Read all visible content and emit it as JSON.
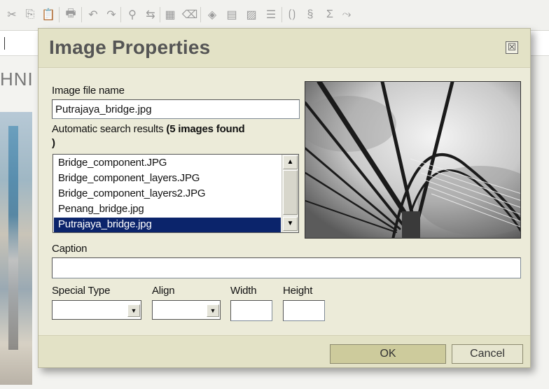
{
  "background": {
    "heading_fragment": "HNI",
    "toolbar_icons": [
      {
        "name": "cut-icon",
        "glyph": "✂"
      },
      {
        "name": "copy-icon",
        "glyph": "⎘"
      },
      {
        "name": "paste-icon",
        "glyph": "📋"
      },
      {
        "name": "print-icon",
        "glyph": "🖶"
      },
      {
        "name": "undo-icon",
        "glyph": "↶"
      },
      {
        "name": "redo-icon",
        "glyph": "↷"
      },
      {
        "name": "find-icon",
        "glyph": "⚲"
      },
      {
        "name": "replace-icon",
        "glyph": "⇆"
      },
      {
        "name": "select-all-icon",
        "glyph": "▦"
      },
      {
        "name": "eraser-icon",
        "glyph": "⌫"
      },
      {
        "name": "object-icon",
        "glyph": "◈"
      },
      {
        "name": "table-icon",
        "glyph": "▤"
      },
      {
        "name": "image-icon",
        "glyph": "▨"
      },
      {
        "name": "horizontal-rule-icon",
        "glyph": "☰"
      },
      {
        "name": "template-icon",
        "glyph": "⟮⟯"
      },
      {
        "name": "special-char-icon",
        "glyph": "§"
      },
      {
        "name": "sum-icon",
        "glyph": "Σ"
      },
      {
        "name": "more-icon",
        "glyph": "⤳"
      }
    ]
  },
  "dialog": {
    "title": "Image Properties",
    "close_label": "☒",
    "file_name": {
      "label": "Image file name",
      "value": "Putrajaya_bridge.jpg"
    },
    "search": {
      "label": "Automatic search results ",
      "count_text": "(5 images found",
      "count_close": ")"
    },
    "results": [
      "Bridge_component.JPG",
      "Bridge_component_layers.JPG",
      "Bridge_component_layers2.JPG",
      "Penang_bridge.jpg",
      "Putrajaya_bridge.jpg"
    ],
    "selected_index": 4,
    "scroll_up": "▲",
    "scroll_down": "▼",
    "caption": {
      "label": "Caption",
      "value": ""
    },
    "special_type": {
      "label": "Special Type",
      "value": ""
    },
    "align": {
      "label": "Align",
      "value": ""
    },
    "width": {
      "label": "Width",
      "value": ""
    },
    "height": {
      "label": "Height",
      "value": ""
    },
    "dropdown_arrow": "▼",
    "ok_label": "OK",
    "cancel_label": "Cancel"
  }
}
